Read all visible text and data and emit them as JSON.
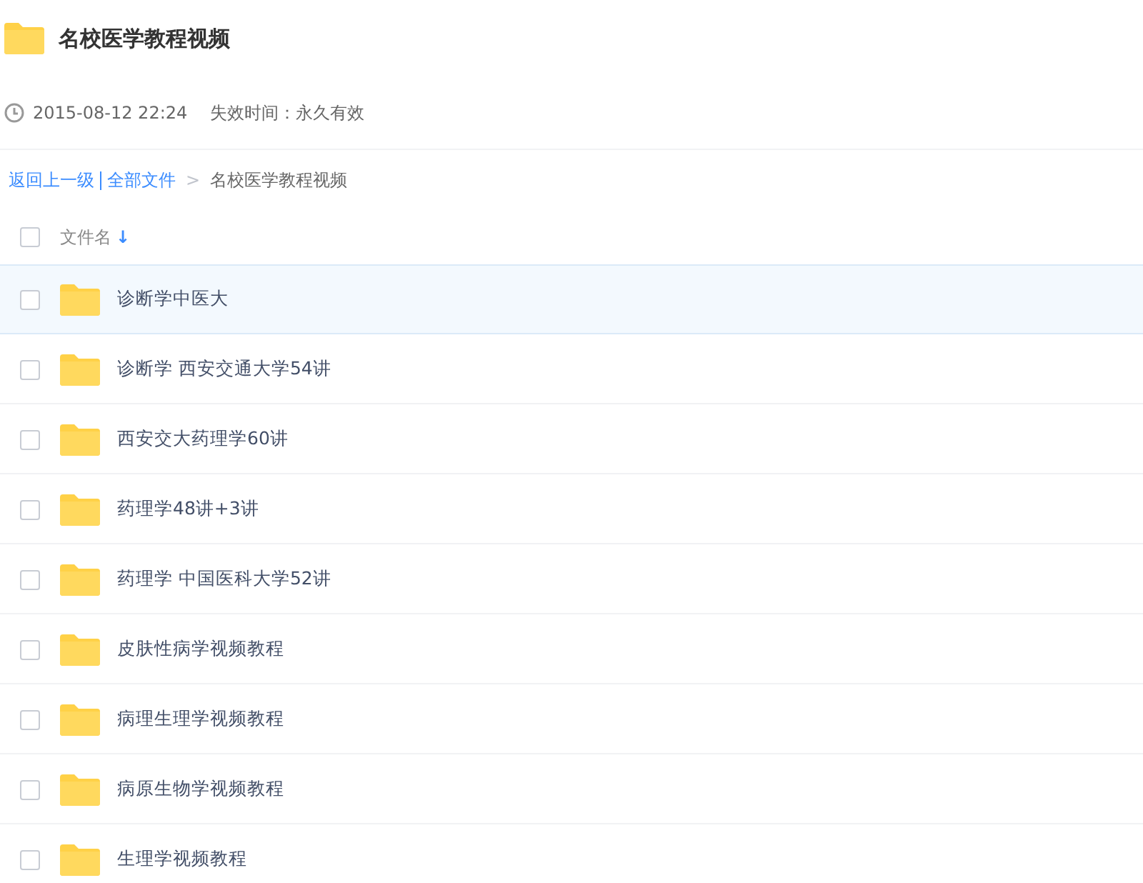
{
  "share": {
    "title": "名校医学教程视频",
    "date": "2015-08-12 22:24",
    "expiry": "失效时间：永久有效"
  },
  "breadcrumb": {
    "back": "返回上一级",
    "root": "全部文件",
    "separator": ">",
    "current": "名校医学教程视频"
  },
  "header": {
    "label": "文件名",
    "sort_arrow": "↓",
    "checked": false
  },
  "files": [
    {
      "name": "诊断学中医大",
      "checked": false,
      "highlighted": true
    },
    {
      "name": "诊断学 西安交通大学54讲",
      "checked": false,
      "highlighted": false
    },
    {
      "name": "西安交大药理学60讲",
      "checked": false,
      "highlighted": false
    },
    {
      "name": "药理学48讲+3讲",
      "checked": false,
      "highlighted": false
    },
    {
      "name": "药理学 中国医科大学52讲",
      "checked": false,
      "highlighted": false
    },
    {
      "name": "皮肤性病学视频教程",
      "checked": false,
      "highlighted": false
    },
    {
      "name": "病理生理学视频教程",
      "checked": false,
      "highlighted": false
    },
    {
      "name": "病原生物学视频教程",
      "checked": false,
      "highlighted": false
    },
    {
      "name": "生理学视频教程",
      "checked": false,
      "highlighted": false
    }
  ]
}
